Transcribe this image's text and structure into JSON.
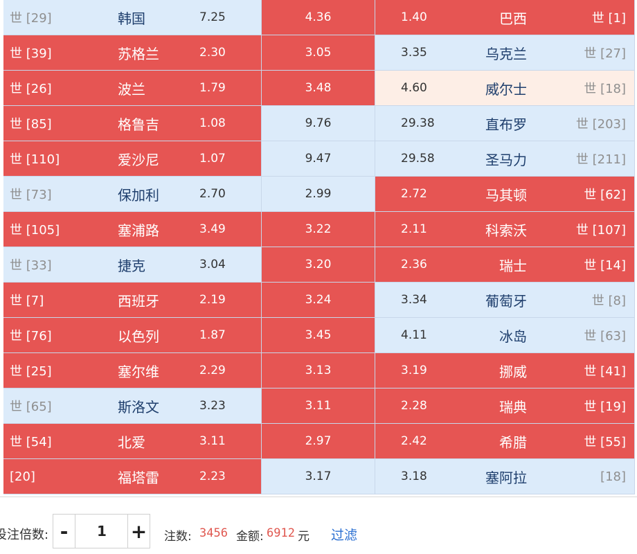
{
  "colors": {
    "win": "#e65553",
    "lose": "#dcebfa",
    "draw_pale": "#fdeee6",
    "link": "#2a6fd2",
    "highlight_number": "#e0574f"
  },
  "matches": [
    {
      "home_rank": "世 [29]",
      "home_team": "韩国",
      "home_odds": "7.25",
      "draw_odds": "4.36",
      "away_odds": "1.40",
      "away_team": "巴西",
      "away_rank": "世 [1]",
      "home_state": "lose",
      "draw_state": "win",
      "away_state": "win"
    },
    {
      "home_rank": "世 [39]",
      "home_team": "苏格兰",
      "home_odds": "2.30",
      "draw_odds": "3.05",
      "away_odds": "3.35",
      "away_team": "乌克兰",
      "away_rank": "世 [27]",
      "home_state": "win",
      "draw_state": "win",
      "away_state": "lose"
    },
    {
      "home_rank": "世 [26]",
      "home_team": "波兰",
      "home_odds": "1.79",
      "draw_odds": "3.48",
      "away_odds": "4.60",
      "away_team": "威尔士",
      "away_rank": "世 [18]",
      "home_state": "win",
      "draw_state": "win",
      "away_state": "pale"
    },
    {
      "home_rank": "世 [85]",
      "home_team": "格鲁吉",
      "home_odds": "1.08",
      "draw_odds": "9.76",
      "away_odds": "29.38",
      "away_team": "直布罗",
      "away_rank": "世 [203]",
      "home_state": "win",
      "draw_state": "lose",
      "away_state": "lose"
    },
    {
      "home_rank": "世 [110]",
      "home_team": "爱沙尼",
      "home_odds": "1.07",
      "draw_odds": "9.47",
      "away_odds": "29.58",
      "away_team": "圣马力",
      "away_rank": "世 [211]",
      "home_state": "win",
      "draw_state": "lose",
      "away_state": "lose"
    },
    {
      "home_rank": "世 [73]",
      "home_team": "保加利",
      "home_odds": "2.70",
      "draw_odds": "2.99",
      "away_odds": "2.72",
      "away_team": "马其顿",
      "away_rank": "世 [62]",
      "home_state": "lose",
      "draw_state": "lose",
      "away_state": "win"
    },
    {
      "home_rank": "世 [105]",
      "home_team": "塞浦路",
      "home_odds": "3.49",
      "draw_odds": "3.22",
      "away_odds": "2.11",
      "away_team": "科索沃",
      "away_rank": "世 [107]",
      "home_state": "win",
      "draw_state": "win",
      "away_state": "win"
    },
    {
      "home_rank": "世 [33]",
      "home_team": "捷克",
      "home_odds": "3.04",
      "draw_odds": "3.20",
      "away_odds": "2.36",
      "away_team": "瑞士",
      "away_rank": "世 [14]",
      "home_state": "lose",
      "draw_state": "win",
      "away_state": "win"
    },
    {
      "home_rank": "世 [7]",
      "home_team": "西班牙",
      "home_odds": "2.19",
      "draw_odds": "3.24",
      "away_odds": "3.34",
      "away_team": "葡萄牙",
      "away_rank": "世 [8]",
      "home_state": "win",
      "draw_state": "win",
      "away_state": "lose"
    },
    {
      "home_rank": "世 [76]",
      "home_team": "以色列",
      "home_odds": "1.87",
      "draw_odds": "3.45",
      "away_odds": "4.11",
      "away_team": "冰岛",
      "away_rank": "世 [63]",
      "home_state": "win",
      "draw_state": "win",
      "away_state": "lose"
    },
    {
      "home_rank": "世 [25]",
      "home_team": "塞尔维",
      "home_odds": "2.29",
      "draw_odds": "3.13",
      "away_odds": "3.19",
      "away_team": "挪威",
      "away_rank": "世 [41]",
      "home_state": "win",
      "draw_state": "win",
      "away_state": "win"
    },
    {
      "home_rank": "世 [65]",
      "home_team": "斯洛文",
      "home_odds": "3.23",
      "draw_odds": "3.11",
      "away_odds": "2.28",
      "away_team": "瑞典",
      "away_rank": "世 [19]",
      "home_state": "lose",
      "draw_state": "win",
      "away_state": "win"
    },
    {
      "home_rank": "世 [54]",
      "home_team": "北爱",
      "home_odds": "3.11",
      "draw_odds": "2.97",
      "away_odds": "2.42",
      "away_team": "希腊",
      "away_rank": "世 [55]",
      "home_state": "win",
      "draw_state": "win",
      "away_state": "win"
    },
    {
      "home_rank": "[20]",
      "home_team": "福塔雷",
      "home_odds": "2.23",
      "draw_odds": "3.17",
      "away_odds": "3.18",
      "away_team": "塞阿拉",
      "away_rank": "[18]",
      "home_state": "win",
      "draw_state": "lose",
      "away_state": "lose"
    }
  ],
  "footer": {
    "multiplier_label": "投注倍数:",
    "minus_label": "-",
    "plus_label": "+",
    "multiplier_value": "1",
    "bets_label": "注数:",
    "bets_value": "3456",
    "amount_label": "金额:",
    "amount_value": "6912",
    "currency": "元",
    "filter_label": "过滤"
  }
}
